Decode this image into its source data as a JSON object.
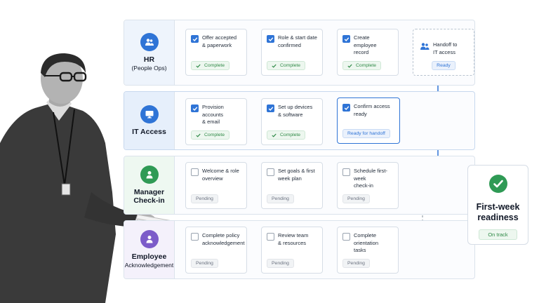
{
  "lanes": {
    "hr": {
      "title": "HR",
      "subtitle": "(People Ops)"
    },
    "it": {
      "title": "IT Access"
    },
    "manager": {
      "title": "Manager",
      "title2": "Check-in"
    },
    "employee": {
      "title": "Employee",
      "subtitle": "Acknowledgement"
    }
  },
  "hr_steps": [
    {
      "line1": "Offer accepted",
      "line2": "& paperwork",
      "status": "Complete"
    },
    {
      "line1": "Role & start date",
      "line2": "confirmed",
      "status": "Complete"
    },
    {
      "line1": "Create employee",
      "line2": "record",
      "status": "Complete"
    },
    {
      "line1": "Handoff to",
      "line2": "IT access",
      "status": "Ready"
    }
  ],
  "it_steps": [
    {
      "line1": "Provision accounts",
      "line2": "& email",
      "status": "Complete"
    },
    {
      "line1": "Set up devices",
      "line2": "& software",
      "status": "Complete"
    },
    {
      "line1": "Confirm access",
      "line2": "ready",
      "status": "Ready for handoff"
    }
  ],
  "manager_steps": [
    {
      "line1": "Welcome & role",
      "line2": "overview",
      "status": "Pending"
    },
    {
      "line1": "Set goals & first",
      "line2": "week plan",
      "status": "Pending"
    },
    {
      "line1": "Schedule first-week",
      "line2": "check-in",
      "status": "Pending"
    }
  ],
  "employee_steps": [
    {
      "line1": "Complete policy",
      "line2": "acknowledgement",
      "status": "Pending"
    },
    {
      "line1": "Review team",
      "line2": "& resources",
      "status": "Pending"
    },
    {
      "line1": "Complete orientation",
      "line2": "tasks",
      "status": "Pending"
    }
  ],
  "outcome": {
    "line1": "First-week",
    "line2": "readiness",
    "status": "On track"
  },
  "colors": {
    "accent_blue": "#2f74d6",
    "hr_icon": "#2f74d6",
    "it_icon": "#2f74d6",
    "manager_icon": "#2f9a55",
    "employee_icon": "#7c5cc9",
    "complete_green": "#2f8a47"
  },
  "icons": {
    "hr": "people-icon",
    "it": "monitor-icon",
    "manager": "person-icon",
    "employee": "person-icon",
    "outcome": "check-circle-icon"
  }
}
